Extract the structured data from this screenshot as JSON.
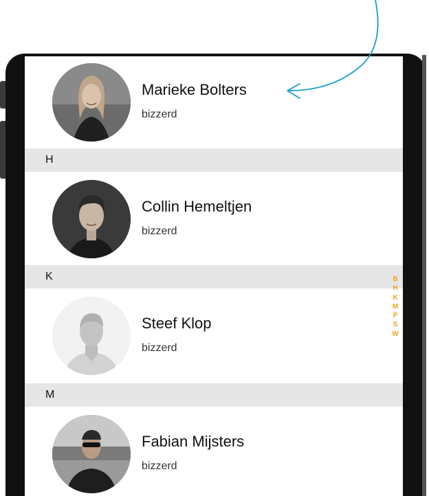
{
  "contacts": [
    {
      "name": "Marieke Bolters",
      "company": "bizzerd",
      "avatar_icon": "person-photo-icon"
    },
    {
      "name": "Collin Hemeltjen",
      "company": "bizzerd",
      "avatar_icon": "person-photo-icon"
    },
    {
      "name": "Steef Klop",
      "company": "bizzerd",
      "avatar_icon": "default-avatar-icon"
    },
    {
      "name": "Fabian Mijsters",
      "company": "bizzerd",
      "avatar_icon": "person-photo-icon"
    }
  ],
  "sections": [
    "H",
    "K",
    "M"
  ],
  "index_letters": [
    "B",
    "H",
    "K",
    "M",
    "P",
    "S",
    "W"
  ],
  "colors": {
    "index_accent": "#f0a21b",
    "annotation_arrow": "#1a9ad6",
    "section_header_bg": "#e6e6e6"
  }
}
